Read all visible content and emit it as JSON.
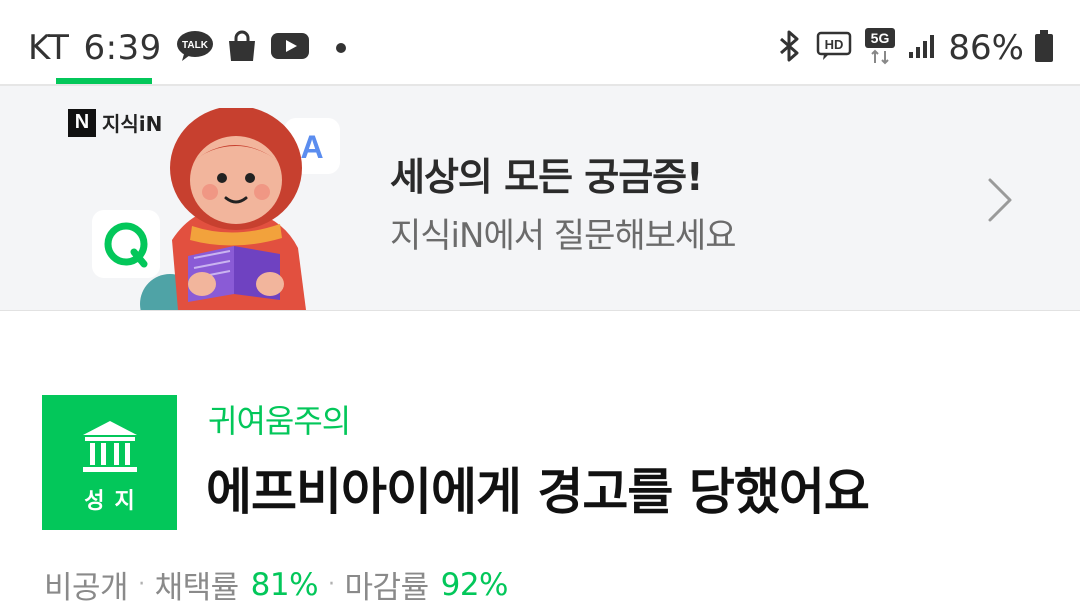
{
  "status_bar": {
    "carrier": "KT",
    "time": "6:39",
    "talk_badge": "TALK",
    "hd_badge": "HD",
    "network": "5G",
    "battery": "86%"
  },
  "banner": {
    "brand_letter": "N",
    "brand_name": "지식iN",
    "title": "세상의 모든 궁금증!",
    "subtitle": "지식iN에서 질문해보세요",
    "bubble_a": "A",
    "bubble_q": "Q"
  },
  "question": {
    "badge_label": "성지",
    "category": "귀여움주의",
    "title": "에프비아이에게 경고를 당했어요",
    "stats": {
      "visibility": "비공개",
      "adoption_label": "채택률",
      "adoption_rate": "81%",
      "closing_label": "마감률",
      "closing_rate": "92%"
    }
  },
  "colors": {
    "accent": "#03c75a",
    "banner_bg": "#f4f5f7",
    "text_muted": "#8a8a8a"
  }
}
